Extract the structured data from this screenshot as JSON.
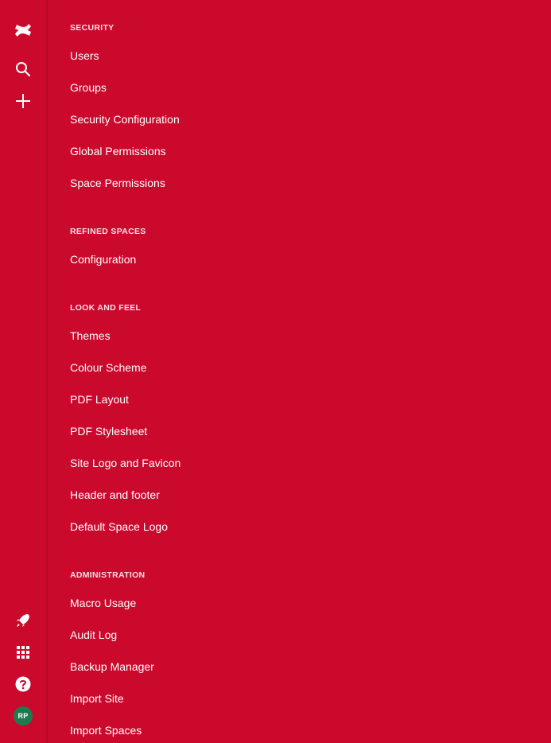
{
  "rail": {
    "top_icons": [
      "confluence-logo-icon",
      "search-icon",
      "plus-icon"
    ],
    "bottom_icons": [
      "rocket-icon",
      "app-switcher-icon",
      "help-icon"
    ],
    "avatar_initials": "RP",
    "avatar_color": "#1E7A4E"
  },
  "theme": {
    "background": "#CA092D",
    "text": "#FFFFFF"
  },
  "sections": [
    {
      "title": "SECURITY",
      "items": [
        "Users",
        "Groups",
        "Security Configuration",
        "Global Permissions",
        "Space Permissions"
      ]
    },
    {
      "title": "REFINED SPACES",
      "items": [
        "Configuration"
      ]
    },
    {
      "title": "LOOK AND FEEL",
      "items": [
        "Themes",
        "Colour Scheme",
        "PDF Layout",
        "PDF Stylesheet",
        "Site Logo and Favicon",
        "Header and footer",
        "Default Space Logo"
      ]
    },
    {
      "title": "ADMINISTRATION",
      "items": [
        "Macro Usage",
        "Audit Log",
        "Backup Manager",
        "Import Site",
        "Import Spaces"
      ]
    }
  ]
}
